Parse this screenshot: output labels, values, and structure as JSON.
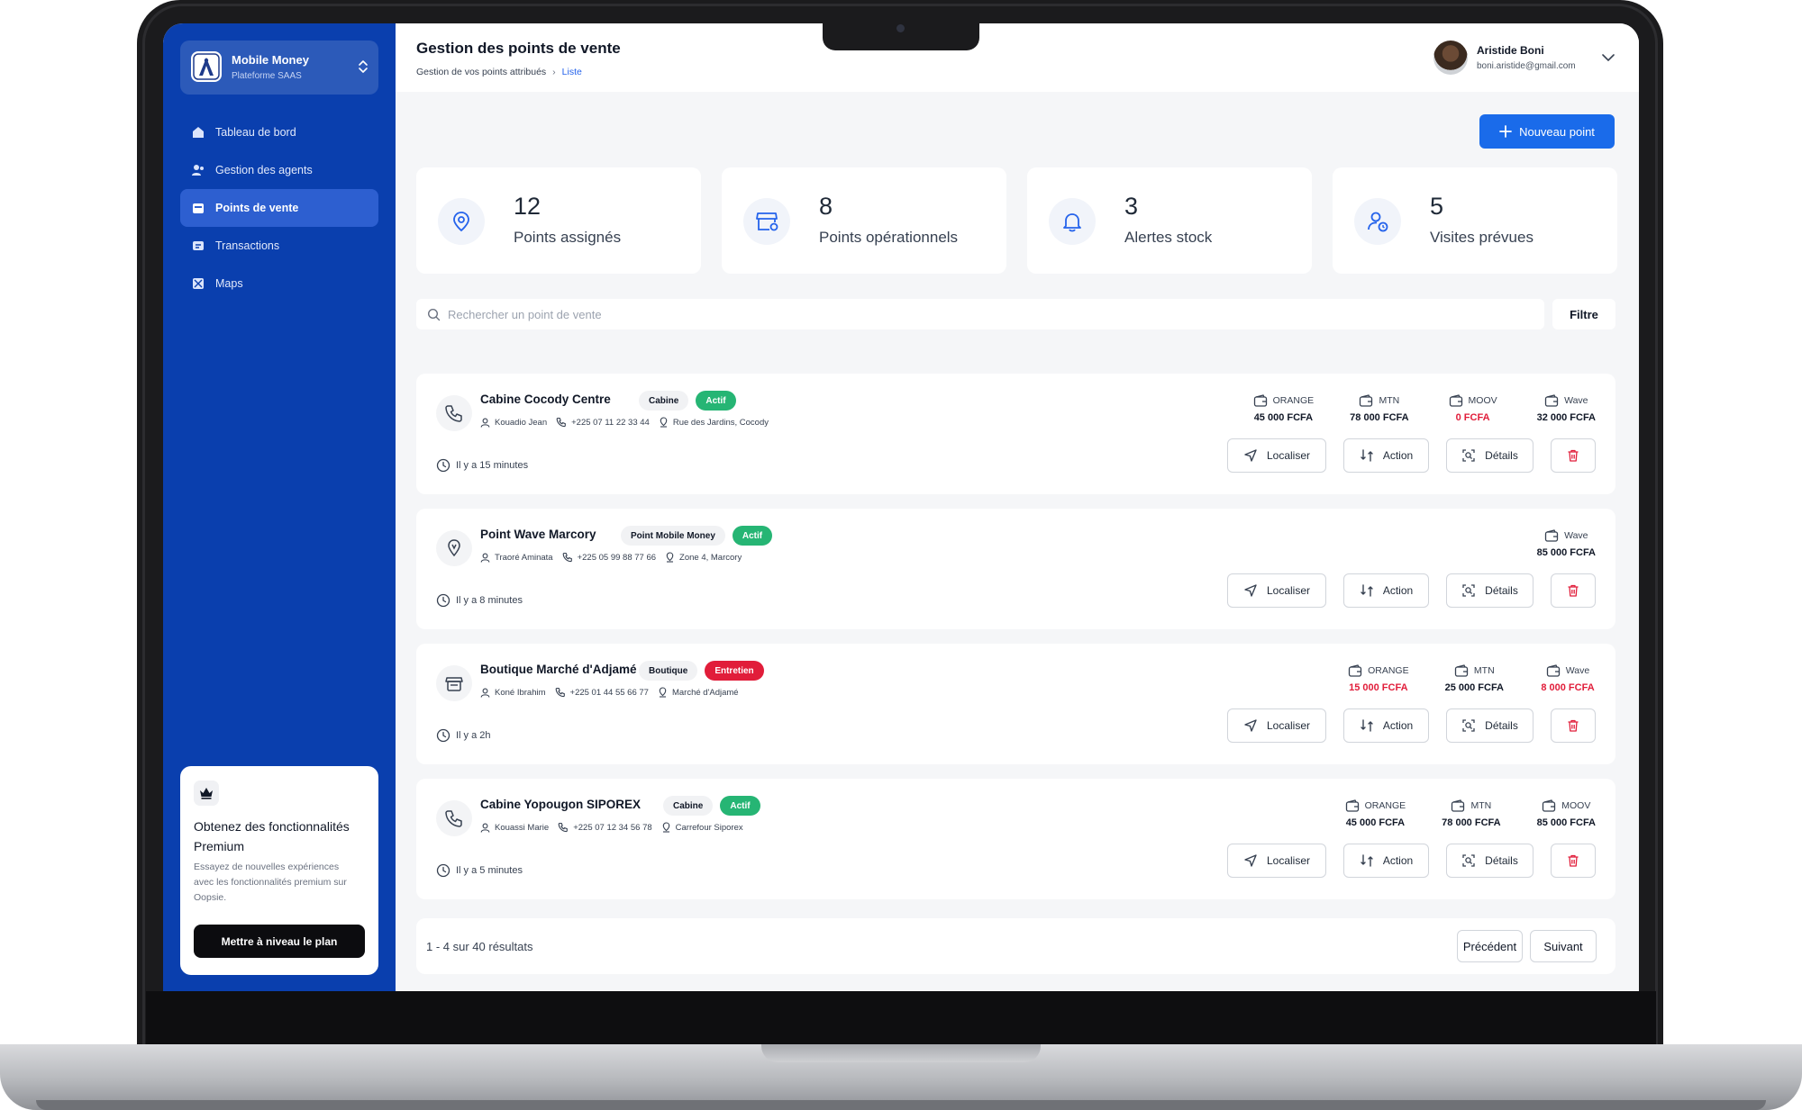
{
  "app": {
    "name": "Mobile Money",
    "subtitle": "Plateforme SAAS"
  },
  "sidebar": {
    "items": [
      {
        "label": "Tableau de bord",
        "icon": "dashboard-icon",
        "active": false
      },
      {
        "label": "Gestion des agents",
        "icon": "users-icon",
        "active": false
      },
      {
        "label": "Points de vente",
        "icon": "store-icon",
        "active": true
      },
      {
        "label": "Transactions",
        "icon": "transactions-icon",
        "active": false
      },
      {
        "label": "Maps",
        "icon": "map-icon",
        "active": false
      }
    ],
    "premium": {
      "title": "Obtenez des fonctionnalités Premium",
      "text": "Essayez de nouvelles expériences avec les fonctionnalités premium sur Oopsie.",
      "button": "Mettre à niveau le plan"
    }
  },
  "header": {
    "title": "Gestion des points de vente",
    "breadcrumb": [
      "Gestion de vos points attribués",
      "Liste"
    ],
    "user": {
      "name": "Aristide Boni",
      "email": "boni.aristide@gmail.com"
    }
  },
  "new_button": "Nouveau point",
  "stats": [
    {
      "value": "12",
      "label": "Points assignés",
      "icon": "location-pin-icon"
    },
    {
      "value": "8",
      "label": "Points opérationnels",
      "icon": "storefront-icon"
    },
    {
      "value": "3",
      "label": "Alertes stock",
      "icon": "bell-alert-icon"
    },
    {
      "value": "5",
      "label": "Visites prévues",
      "icon": "user-clock-icon"
    }
  ],
  "search": {
    "placeholder": "Rechercher un point de vente",
    "filter": "Filtre"
  },
  "actions": {
    "locate": "Localiser",
    "action": "Action",
    "details": "Détails"
  },
  "points": [
    {
      "name": "Cabine Cocody Centre",
      "type": "Cabine",
      "status": "Actif",
      "status_color": "#26b574",
      "agent": "Kouadio Jean",
      "phone": "+225 07 11 22 33 44",
      "address": "Rue des Jardins, Cocody",
      "time": "Il y a 15 minutes",
      "balances": [
        {
          "operator": "ORANGE",
          "amount": "45 000 FCFA",
          "low": false
        },
        {
          "operator": "MTN",
          "amount": "78 000 FCFA",
          "low": false
        },
        {
          "operator": "MOOV",
          "amount": "0 FCFA",
          "low": true
        },
        {
          "operator": "Wave",
          "amount": "32 000 FCFA",
          "low": false
        }
      ]
    },
    {
      "name": "Point Wave Marcory",
      "type": "Point Mobile Money",
      "status": "Actif",
      "status_color": "#26b574",
      "agent": "Traoré Aminata",
      "phone": "+225 05 99 88 77 66",
      "address": "Zone 4, Marcory",
      "time": "Il y a 8 minutes",
      "balances": [
        {
          "operator": "Wave",
          "amount": "85 000 FCFA",
          "low": false
        }
      ]
    },
    {
      "name": "Boutique Marché d'Adjamé",
      "type": "Boutique",
      "status": "Entretien",
      "status_color": "#e11d3a",
      "agent": "Koné Ibrahim",
      "phone": "+225 01 44 55 66 77",
      "address": "Marché d'Adjamé",
      "time": "Il y a 2h",
      "balances": [
        {
          "operator": "ORANGE",
          "amount": "15 000 FCFA",
          "low": true
        },
        {
          "operator": "MTN",
          "amount": "25 000 FCFA",
          "low": false
        },
        {
          "operator": "Wave",
          "amount": "8 000 FCFA",
          "low": true
        }
      ]
    },
    {
      "name": "Cabine Yopougon SIPOREX",
      "type": "Cabine",
      "status": "Actif",
      "status_color": "#26b574",
      "agent": "Kouassi Marie",
      "phone": "+225 07 12 34 56 78",
      "address": "Carrefour Siporex",
      "time": "Il y a 5 minutes",
      "balances": [
        {
          "operator": "ORANGE",
          "amount": "45 000 FCFA",
          "low": false
        },
        {
          "operator": "MTN",
          "amount": "78 000 FCFA",
          "low": false
        },
        {
          "operator": "MOOV",
          "amount": "85 000 FCFA",
          "low": false
        }
      ]
    }
  ],
  "pagination": {
    "summary": "1 - 4 sur 40 résultats",
    "prev": "Précédent",
    "next": "Suivant"
  },
  "colors": {
    "sidebar": "#0a3fae",
    "accent": "#1a6bea",
    "success": "#26b574",
    "danger": "#e11d3a"
  }
}
